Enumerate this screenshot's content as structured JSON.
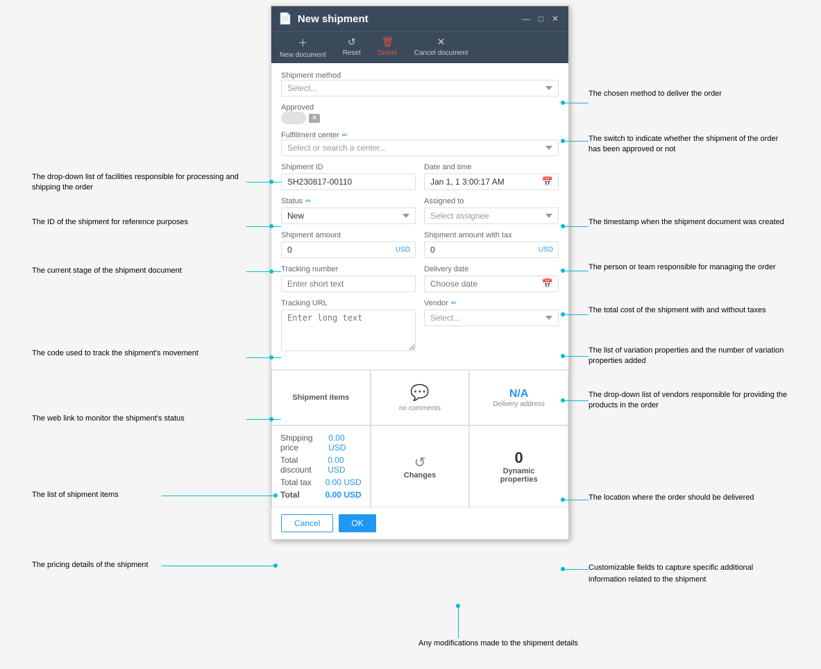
{
  "window": {
    "title": "New shipment",
    "min_btn": "—",
    "max_btn": "□",
    "close_btn": "✕"
  },
  "toolbar": {
    "new_document": "New document",
    "reset": "Reset",
    "delete": "Delete",
    "cancel_document": "Cancel document"
  },
  "form": {
    "shipment_method_label": "Shipment method",
    "shipment_method_placeholder": "Select...",
    "approved_label": "Approved",
    "fulfillment_label": "Fulfillment center",
    "fulfillment_placeholder": "Select or search a center...",
    "shipment_id_label": "Shipment ID",
    "shipment_id_value": "SH230817-00110",
    "date_time_label": "Date and time",
    "date_time_value": "Jan 1, 1 3:00:17 AM",
    "status_label": "Status",
    "status_value": "New",
    "assigned_to_label": "Assigned to",
    "assigned_to_placeholder": "Select assignee",
    "shipment_amount_label": "Shipment amount",
    "shipment_amount_value": "0",
    "currency": "USD",
    "shipment_amount_tax_label": "Shipment amount with tax",
    "shipment_amount_tax_value": "0",
    "tracking_number_label": "Tracking number",
    "tracking_number_placeholder": "Enter short text",
    "delivery_date_label": "Delivery date",
    "delivery_date_placeholder": "Choose date",
    "tracking_url_label": "Tracking URL",
    "tracking_url_placeholder": "Enter long text",
    "vendor_label": "Vendor",
    "vendor_placeholder": "Select..."
  },
  "panels": {
    "shipment_items": "Shipment items",
    "no_comments_icon": "💬",
    "no_comments_text": "no comments",
    "delivery_address_value": "N/A",
    "delivery_address_label": "Delivery address",
    "changes_icon": "↺",
    "changes_label": "Changes",
    "dynamic_properties_value": "0",
    "dynamic_properties_label": "Dynamic\nproperties"
  },
  "pricing": {
    "shipping_price_label": "Shipping price",
    "shipping_price_value": "0.00 USD",
    "total_discount_label": "Total discount",
    "total_discount_value": "0.00 USD",
    "total_tax_label": "Total tax",
    "total_tax_value": "0.00 USD",
    "total_label": "Total",
    "total_value": "0.00 USD"
  },
  "buttons": {
    "cancel": "Cancel",
    "ok": "OK"
  },
  "annotations": {
    "shipment_method": "The chosen method to deliver the order",
    "approved": "The switch to indicate whether the shipment\nof the order has been approved or not",
    "fulfillment": "The drop-down list of facilities responsible for\nprocessing and shipping the order",
    "shipment_id": "The ID of the shipment for reference\npurposes",
    "date_time": "The timestamp when the shipment document\nwas created",
    "status": "The current stage of the shipment document",
    "assigned_to": "The person or team responsible for managing\nthe order",
    "shipment_amount": "The total cost of the shipment with and without\ntaxes",
    "tracking_number": "The code used to track the shipment's\nmovement",
    "delivery_date": "The list of variation properties and the number\nof variation properties added",
    "vendor": "The drop-down list of vendors responsible for\nproviding the products in the order",
    "tracking_url": "The web link to monitor the shipment's status",
    "shipment_items": "The list of shipment items",
    "delivery_address": "The location where the order should be\ndelivered",
    "pricing": "The pricing details of the shipment",
    "dynamic_properties": " Customizable fields to capture specific\nadditional information related to the\nshipment",
    "changes": "Any modifications made to the shipment\ndetails"
  }
}
